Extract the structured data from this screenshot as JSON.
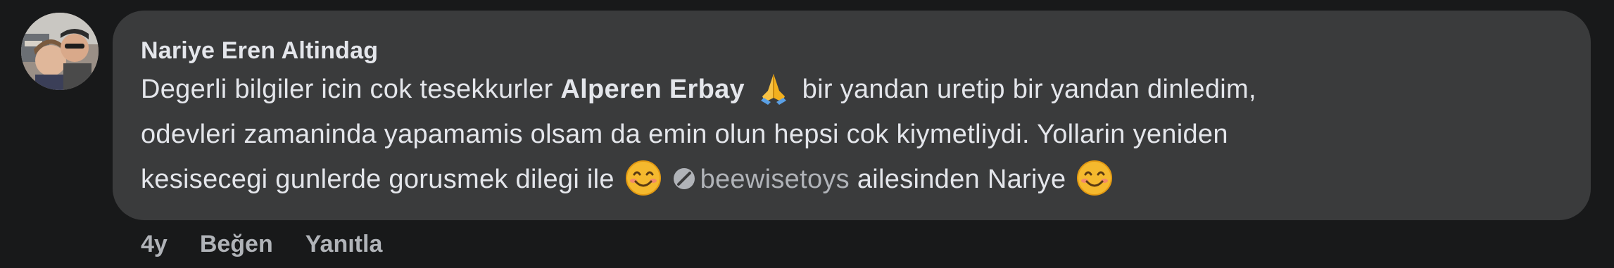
{
  "comment": {
    "author": "Nariye Eren Altindag",
    "text_part1": "Degerli bilgiler icin cok tesekkurler ",
    "mention": "Alperen Erbay",
    "text_part2": " bir yandan uretip bir yandan dinledim,",
    "line2": "odevleri zamaninda yapamamis olsam da emin olun hepsi cok kiymetliydi. Yollarin yeniden",
    "line3_part1": "kesisecegi gunlerde gorusmek dilegi ile ",
    "page_tag": "beewisetoys",
    "line3_part2": " ailesinden Nariye ",
    "emojis": [
      "folded-hands",
      "smiling-face",
      "smiling-face"
    ]
  },
  "actions": {
    "time": "4y",
    "like_label": "Beğen",
    "reply_label": "Yanıtla"
  },
  "colors": {
    "background": "#18191a",
    "bubble": "#3a3b3c",
    "text": "#e4e6eb",
    "secondary": "#b0b3b8"
  }
}
